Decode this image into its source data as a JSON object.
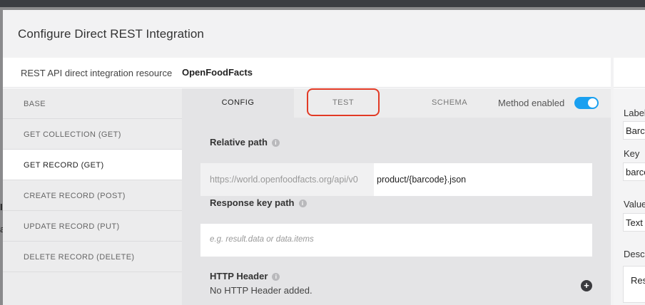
{
  "modal": {
    "title": "Configure Direct REST Integration"
  },
  "resource": {
    "label": "REST API direct integration resource",
    "name": "OpenFoodFacts"
  },
  "sidebar": {
    "items": [
      {
        "label": "BASE",
        "active": false
      },
      {
        "label": "GET COLLECTION (GET)",
        "active": false
      },
      {
        "label": "GET RECORD (GET)",
        "active": true
      },
      {
        "label": "CREATE RECORD (POST)",
        "active": false
      },
      {
        "label": "UPDATE RECORD (PUT)",
        "active": false
      },
      {
        "label": "DELETE RECORD (DELETE)",
        "active": false
      }
    ]
  },
  "tabs": [
    {
      "label": "CONFIG",
      "active": true
    },
    {
      "label": "TEST",
      "active": false,
      "highlighted": true
    },
    {
      "label": "SCHEMA",
      "active": false
    }
  ],
  "method": {
    "label": "Method enabled",
    "enabled": true
  },
  "relative_path": {
    "label": "Relative path",
    "prefix": "https://world.openfoodfacts.org/api/v0",
    "value": "product/{barcode}.json"
  },
  "response_key_path": {
    "label": "Response key path",
    "placeholder": "e.g. result.data or data.items"
  },
  "http_header": {
    "label": "HTTP Header",
    "empty_text": "No HTTP Header added."
  },
  "right_panel": {
    "label_field": {
      "label": "Label",
      "value": "Barcode"
    },
    "key_field": {
      "label": "Key",
      "value": "barcode"
    },
    "value_field": {
      "label": "Value",
      "value": "Text"
    },
    "description_field": {
      "label": "Description",
      "value": "Res"
    }
  },
  "colors": {
    "accent": "#1aa0f0",
    "highlight": "#e23a25"
  },
  "icons": {
    "info": "info-icon",
    "add": "plus-circle-icon"
  }
}
